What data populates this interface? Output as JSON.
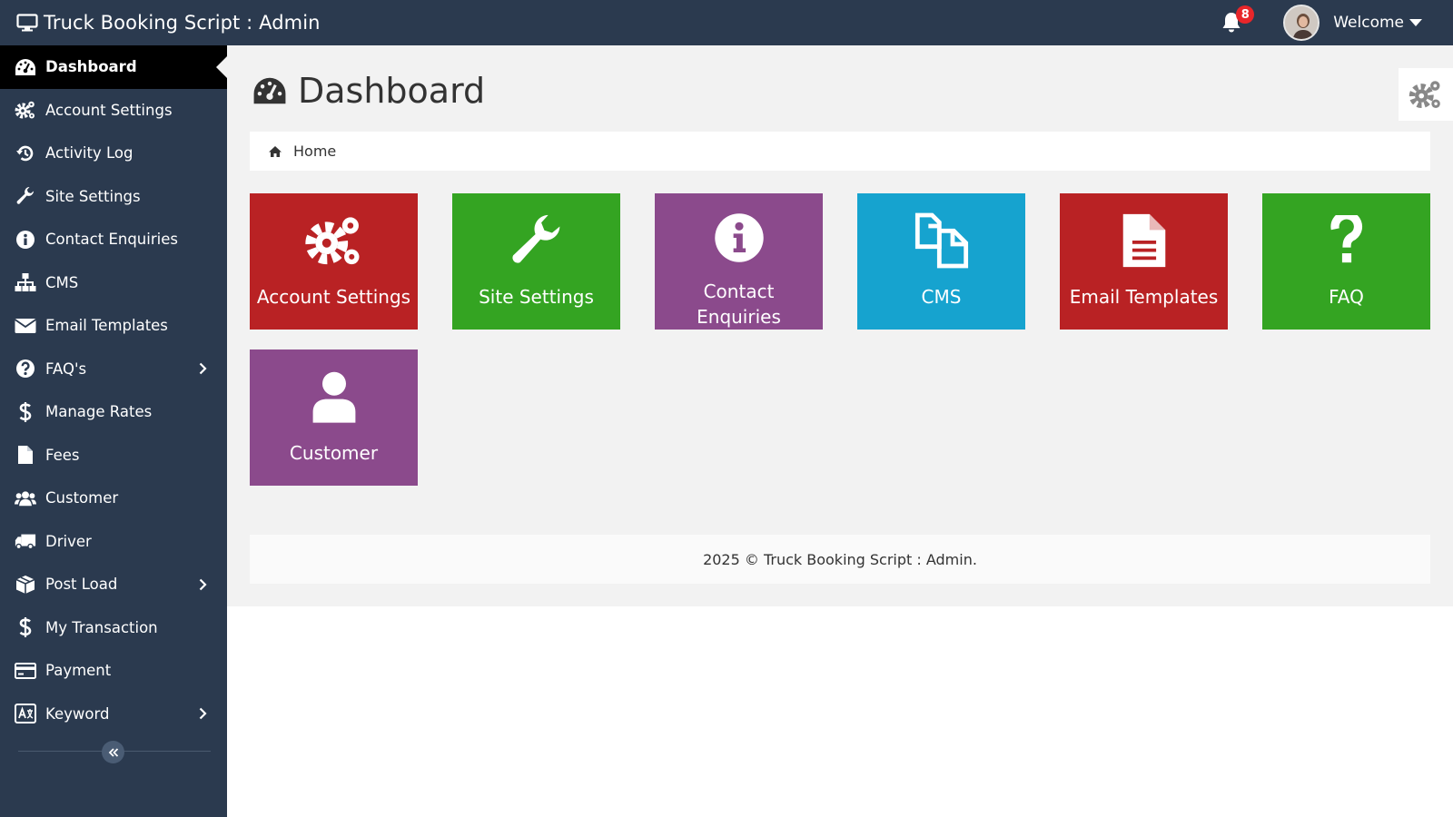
{
  "app": {
    "title": "Truck Booking Script : Admin"
  },
  "header": {
    "notification_count": "8",
    "welcome_label": "Welcome"
  },
  "sidebar": {
    "items": [
      {
        "label": "Dashboard"
      },
      {
        "label": "Account Settings"
      },
      {
        "label": "Activity Log"
      },
      {
        "label": "Site Settings"
      },
      {
        "label": "Contact Enquiries"
      },
      {
        "label": "CMS"
      },
      {
        "label": "Email Templates"
      },
      {
        "label": "FAQ's"
      },
      {
        "label": "Manage Rates"
      },
      {
        "label": "Fees"
      },
      {
        "label": "Customer"
      },
      {
        "label": "Driver"
      },
      {
        "label": "Post Load"
      },
      {
        "label": "My Transaction"
      },
      {
        "label": "Payment"
      },
      {
        "label": "Keyword"
      }
    ]
  },
  "main": {
    "page_title": "Dashboard",
    "breadcrumb": "Home",
    "tiles": [
      {
        "label": "Account Settings",
        "color": "#b92224"
      },
      {
        "label": "Site Settings",
        "color": "#34a422"
      },
      {
        "label": "Contact Enquiries",
        "color": "#8b4a8c"
      },
      {
        "label": "CMS",
        "color": "#16a3cf"
      },
      {
        "label": "Email Templates",
        "color": "#b92224"
      },
      {
        "label": "FAQ",
        "color": "#34a422"
      },
      {
        "label": "Customer",
        "color": "#8b4a8c"
      }
    ],
    "footer": "2025 © Truck Booking Script : Admin."
  },
  "colors": {
    "topbar": "#2b3a4f",
    "sidebar": "#2b3a4f",
    "active_item": "#000000",
    "badge": "#e8262a"
  }
}
